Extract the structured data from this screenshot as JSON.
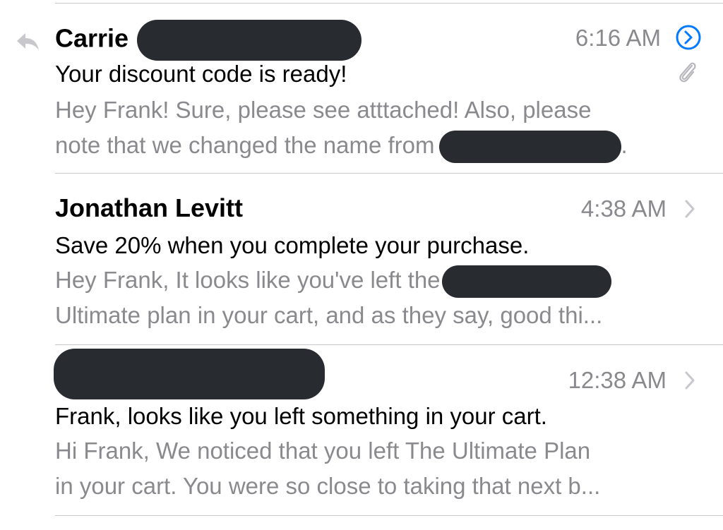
{
  "messages": [
    {
      "sender": "Carrie",
      "time": "6:16 AM",
      "subject": "Your discount code is ready!",
      "preview_line1": "Hey Frank! Sure, please see atttached! Also, please",
      "preview_line2": "note that we changed the name from",
      "preview_line2_tail": ".",
      "replied": true,
      "has_attachment": true,
      "icons": [
        "reply-icon",
        "circle-chevron-right-icon",
        "paperclip-icon"
      ]
    },
    {
      "sender": "Jonathan Levitt",
      "time": "4:38 AM",
      "subject": "Save 20% when you complete your purchase.",
      "preview_line1": "Hey Frank, It looks like you've left the",
      "preview_line2": "Ultimate plan in your cart, and as they say, good thi...",
      "icons": [
        "chevron-right-icon"
      ]
    },
    {
      "sender": "",
      "time": "12:38 AM",
      "subject": "Frank, looks like you left something in your cart.",
      "preview_line1": "Hi Frank, We noticed that you left The Ultimate Plan",
      "preview_line2": "in your cart. You were so close to taking that next b...",
      "icons": [
        "chevron-right-icon"
      ]
    }
  ],
  "colors": {
    "accent": "#007aff",
    "secondary_text": "#8a8a8e",
    "divider": "#c8c8cc",
    "redaction": "#282b30"
  }
}
